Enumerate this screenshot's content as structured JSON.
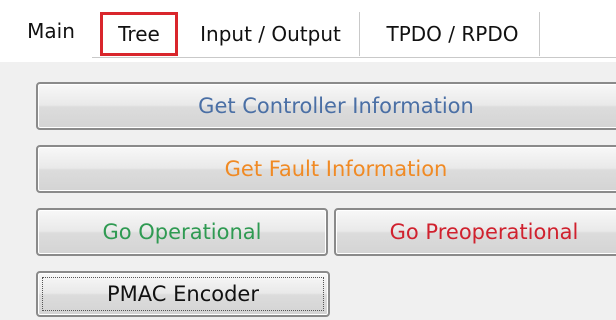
{
  "tabs": [
    {
      "label": "Main"
    },
    {
      "label": "Tree"
    },
    {
      "label": "Input / Output"
    },
    {
      "label": "TPDO / RPDO"
    }
  ],
  "buttons": {
    "get_controller_info": "Get Controller Information",
    "get_fault_info": "Get Fault Information",
    "go_operational": "Go Operational",
    "go_preoperational": "Go Preoperational",
    "pmac_encoder": "PMAC Encoder"
  },
  "colors": {
    "highlight_box": "#d9262c",
    "controller_text": "#4a6fa5",
    "fault_text": "#f08a24",
    "operational_text": "#2f9a52",
    "preoperational_text": "#d0212e"
  }
}
